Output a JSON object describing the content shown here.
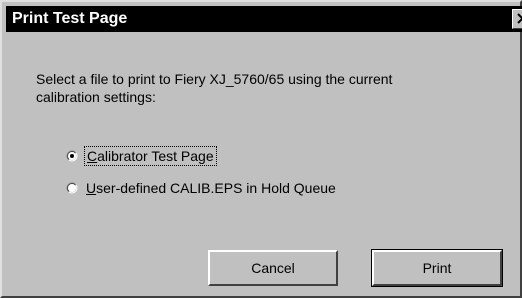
{
  "window": {
    "title": "Print Test Page",
    "close_label": "×"
  },
  "message": {
    "line1": "Select a file to print to Fiery XJ_5760/65 using the current",
    "line2": "calibration settings:"
  },
  "options": [
    {
      "label": "Calibrator Test Page",
      "mnemonic": "C",
      "rest": "alibrator Test Page",
      "selected": true
    },
    {
      "label": "User-defined CALIB.EPS in Hold Queue",
      "mnemonic": "U",
      "rest": "ser-defined CALIB.EPS in Hold Queue",
      "selected": false
    }
  ],
  "buttons": {
    "cancel_label": "Cancel",
    "print_label": "Print"
  }
}
